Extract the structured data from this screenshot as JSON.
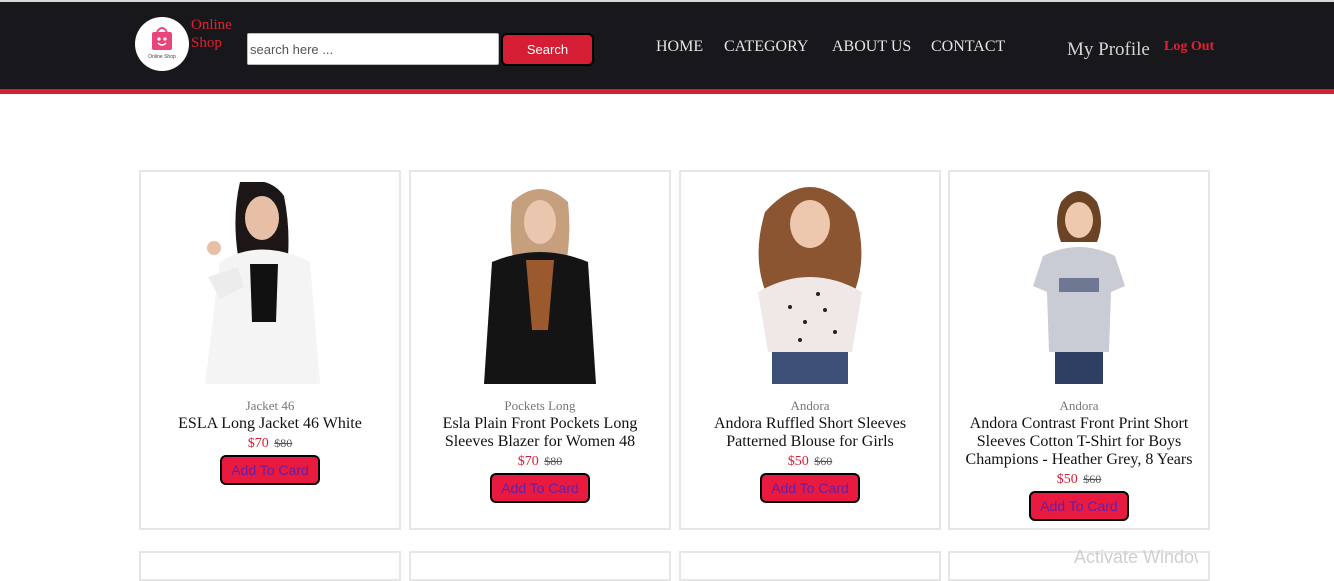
{
  "header": {
    "brand": [
      "Online",
      "Shop"
    ],
    "logo_text": "Online Shop",
    "search": {
      "placeholder": "search here ...",
      "value": "",
      "button": "Search"
    },
    "nav": [
      "HOME",
      "CATEGORY",
      "ABOUT US",
      "CONTACT"
    ],
    "profile": "My Profile",
    "logout": "Log Out"
  },
  "products": [
    {
      "category": "Jacket 46",
      "title": "ESLA Long Jacket 46 White",
      "price": "$70",
      "old_price": "$80",
      "button": "Add To Card",
      "image": "woman-white-jacket-photo"
    },
    {
      "category": "Pockets Long",
      "title": "Esla Plain Front Pockets Long Sleeves Blazer for Women 48",
      "price": "$70",
      "old_price": "$80",
      "button": "Add To Card",
      "image": "woman-black-blazer-photo"
    },
    {
      "category": "Andora",
      "title": "Andora Ruffled Short Sleeves Patterned Blouse for Girls",
      "price": "$50",
      "old_price": "$60",
      "button": "Add To Card",
      "image": "girl-patterned-blouse-photo"
    },
    {
      "category": "Andora",
      "title": "Andora Contrast Front Print Short Sleeves Cotton T-Shirt for Boys Champions - Heather Grey, 8 Years",
      "price": "$50",
      "old_price": "$60",
      "button": "Add To Card",
      "image": "boy-grey-tshirt-photo"
    }
  ],
  "watermark": "Activate Windows",
  "colors": {
    "header_bg": "#17171c",
    "accent": "#d52134",
    "button_text": "#6a1ea6"
  }
}
